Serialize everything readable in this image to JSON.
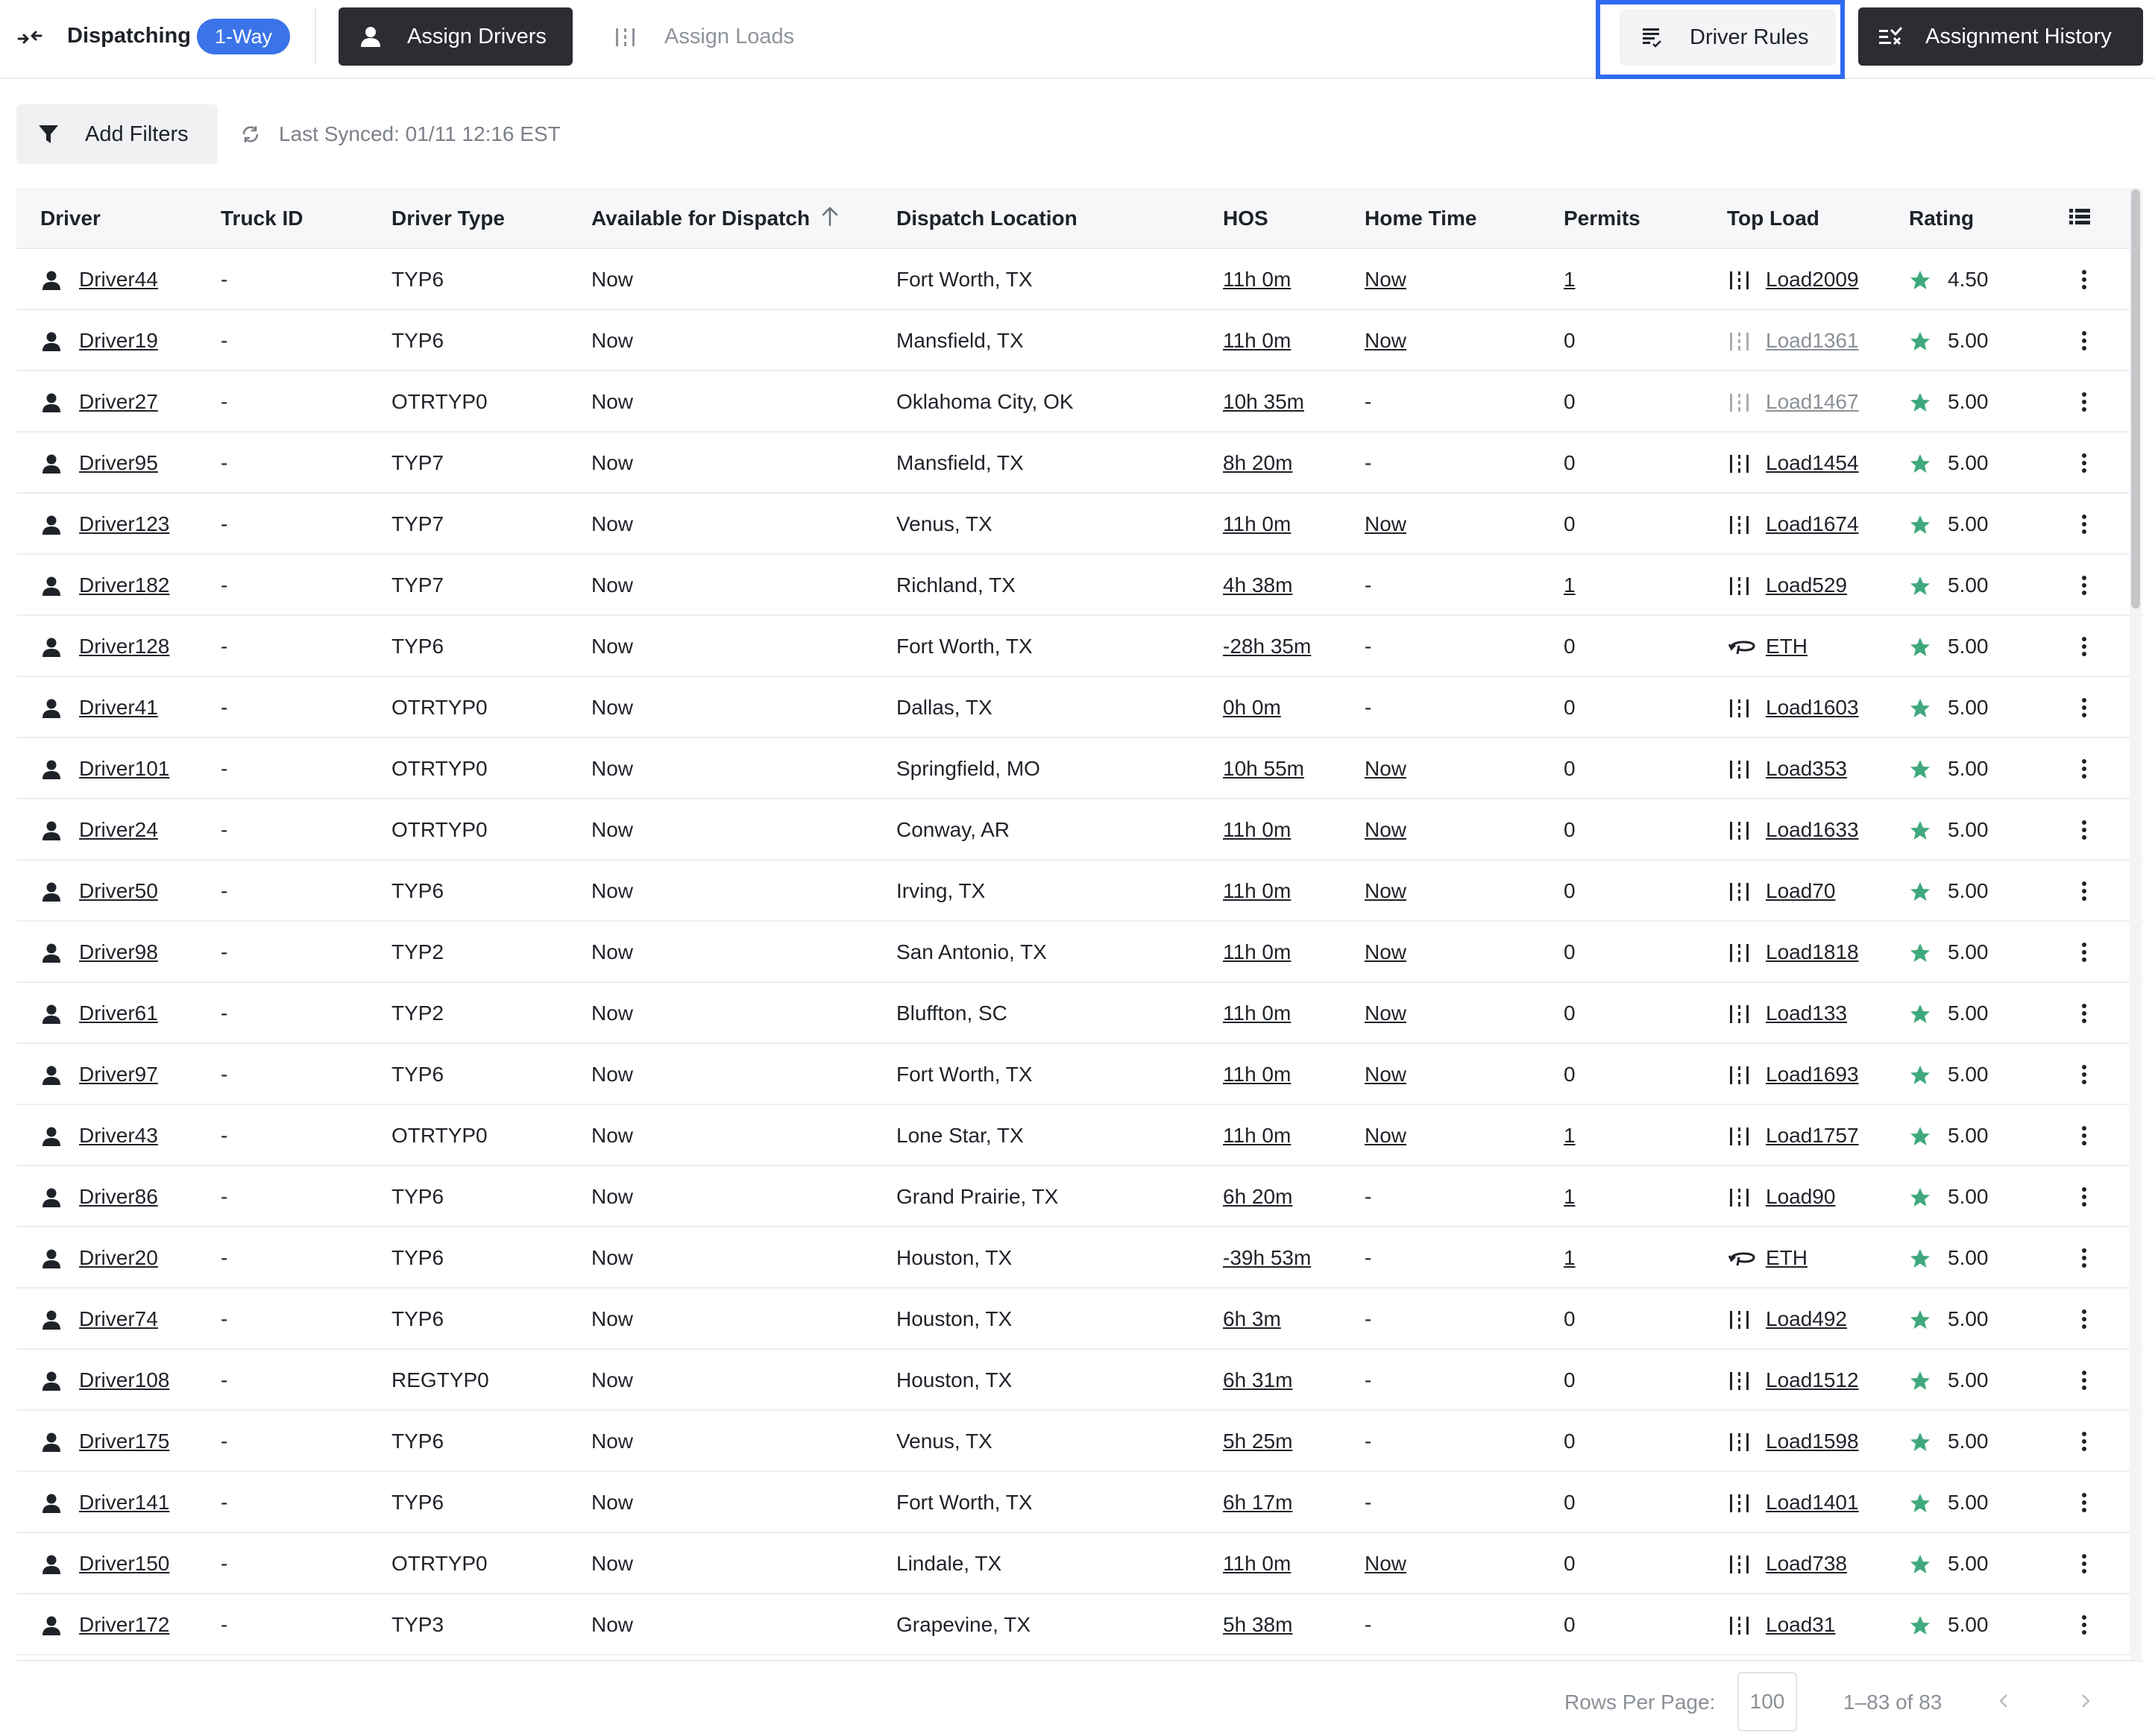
{
  "header": {
    "title": "Dispatching",
    "mode_badge": "1-Way",
    "tabs": [
      {
        "label": "Assign Drivers"
      },
      {
        "label": "Assign Loads"
      }
    ],
    "driver_rules_label": "Driver Rules",
    "assignment_history_label": "Assignment History"
  },
  "toolbar": {
    "add_filters_label": "Add Filters",
    "last_synced": "Last Synced: 01/11 12:16 EST"
  },
  "table": {
    "columns": [
      "Driver",
      "Truck ID",
      "Driver Type",
      "Available for Dispatch",
      "Dispatch Location",
      "HOS",
      "Home Time",
      "Permits",
      "Top Load",
      "Rating"
    ],
    "rows": [
      {
        "driver": "Driver44",
        "truck": "-",
        "type": "TYP6",
        "available": "Now",
        "location": "Fort Worth, TX",
        "hos": "11h 0m",
        "home": "Now",
        "permits": "1",
        "load": "Load2009",
        "load_kind": "load",
        "load_muted": false,
        "rating": "4.50"
      },
      {
        "driver": "Driver19",
        "truck": "-",
        "type": "TYP6",
        "available": "Now",
        "location": "Mansfield, TX",
        "hos": "11h 0m",
        "home": "Now",
        "permits": "0",
        "load": "Load1361",
        "load_kind": "load",
        "load_muted": true,
        "rating": "5.00"
      },
      {
        "driver": "Driver27",
        "truck": "-",
        "type": "OTRTYP0",
        "available": "Now",
        "location": "Oklahoma City, OK",
        "hos": "10h 35m",
        "home": "-",
        "permits": "0",
        "load": "Load1467",
        "load_kind": "load",
        "load_muted": true,
        "rating": "5.00"
      },
      {
        "driver": "Driver95",
        "truck": "-",
        "type": "TYP7",
        "available": "Now",
        "location": "Mansfield, TX",
        "hos": "8h 20m",
        "home": "-",
        "permits": "0",
        "load": "Load1454",
        "load_kind": "load",
        "load_muted": false,
        "rating": "5.00"
      },
      {
        "driver": "Driver123",
        "truck": "-",
        "type": "TYP7",
        "available": "Now",
        "location": "Venus, TX",
        "hos": "11h 0m",
        "home": "Now",
        "permits": "0",
        "load": "Load1674",
        "load_kind": "load",
        "load_muted": false,
        "rating": "5.00"
      },
      {
        "driver": "Driver182",
        "truck": "-",
        "type": "TYP7",
        "available": "Now",
        "location": "Richland, TX",
        "hos": "4h 38m",
        "home": "-",
        "permits": "1",
        "load": "Load529",
        "load_kind": "load",
        "load_muted": false,
        "rating": "5.00"
      },
      {
        "driver": "Driver128",
        "truck": "-",
        "type": "TYP6",
        "available": "Now",
        "location": "Fort Worth, TX",
        "hos": "-28h 35m",
        "home": "-",
        "permits": "0",
        "load": "ETH",
        "load_kind": "home",
        "load_muted": false,
        "rating": "5.00"
      },
      {
        "driver": "Driver41",
        "truck": "-",
        "type": "OTRTYP0",
        "available": "Now",
        "location": "Dallas, TX",
        "hos": "0h 0m",
        "home": "-",
        "permits": "0",
        "load": "Load1603",
        "load_kind": "load",
        "load_muted": false,
        "rating": "5.00"
      },
      {
        "driver": "Driver101",
        "truck": "-",
        "type": "OTRTYP0",
        "available": "Now",
        "location": "Springfield, MO",
        "hos": "10h 55m",
        "home": "Now",
        "permits": "0",
        "load": "Load353",
        "load_kind": "load",
        "load_muted": false,
        "rating": "5.00"
      },
      {
        "driver": "Driver24",
        "truck": "-",
        "type": "OTRTYP0",
        "available": "Now",
        "location": "Conway, AR",
        "hos": "11h 0m",
        "home": "Now",
        "permits": "0",
        "load": "Load1633",
        "load_kind": "load",
        "load_muted": false,
        "rating": "5.00"
      },
      {
        "driver": "Driver50",
        "truck": "-",
        "type": "TYP6",
        "available": "Now",
        "location": "Irving, TX",
        "hos": "11h 0m",
        "home": "Now",
        "permits": "0",
        "load": "Load70",
        "load_kind": "load",
        "load_muted": false,
        "rating": "5.00"
      },
      {
        "driver": "Driver98",
        "truck": "-",
        "type": "TYP2",
        "available": "Now",
        "location": "San Antonio, TX",
        "hos": "11h 0m",
        "home": "Now",
        "permits": "0",
        "load": "Load1818",
        "load_kind": "load",
        "load_muted": false,
        "rating": "5.00"
      },
      {
        "driver": "Driver61",
        "truck": "-",
        "type": "TYP2",
        "available": "Now",
        "location": "Bluffton, SC",
        "hos": "11h 0m",
        "home": "Now",
        "permits": "0",
        "load": "Load133",
        "load_kind": "load",
        "load_muted": false,
        "rating": "5.00"
      },
      {
        "driver": "Driver97",
        "truck": "-",
        "type": "TYP6",
        "available": "Now",
        "location": "Fort Worth, TX",
        "hos": "11h 0m",
        "home": "Now",
        "permits": "0",
        "load": "Load1693",
        "load_kind": "load",
        "load_muted": false,
        "rating": "5.00"
      },
      {
        "driver": "Driver43",
        "truck": "-",
        "type": "OTRTYP0",
        "available": "Now",
        "location": "Lone Star, TX",
        "hos": "11h 0m",
        "home": "Now",
        "permits": "1",
        "load": "Load1757",
        "load_kind": "load",
        "load_muted": false,
        "rating": "5.00"
      },
      {
        "driver": "Driver86",
        "truck": "-",
        "type": "TYP6",
        "available": "Now",
        "location": "Grand Prairie, TX",
        "hos": "6h 20m",
        "home": "-",
        "permits": "1",
        "load": "Load90",
        "load_kind": "load",
        "load_muted": false,
        "rating": "5.00"
      },
      {
        "driver": "Driver20",
        "truck": "-",
        "type": "TYP6",
        "available": "Now",
        "location": "Houston, TX",
        "hos": "-39h 53m",
        "home": "-",
        "permits": "1",
        "load": "ETH",
        "load_kind": "home",
        "load_muted": false,
        "rating": "5.00"
      },
      {
        "driver": "Driver74",
        "truck": "-",
        "type": "TYP6",
        "available": "Now",
        "location": "Houston, TX",
        "hos": "6h 3m",
        "home": "-",
        "permits": "0",
        "load": "Load492",
        "load_kind": "load",
        "load_muted": false,
        "rating": "5.00"
      },
      {
        "driver": "Driver108",
        "truck": "-",
        "type": "REGTYP0",
        "available": "Now",
        "location": "Houston, TX",
        "hos": "6h 31m",
        "home": "-",
        "permits": "0",
        "load": "Load1512",
        "load_kind": "load",
        "load_muted": false,
        "rating": "5.00"
      },
      {
        "driver": "Driver175",
        "truck": "-",
        "type": "TYP6",
        "available": "Now",
        "location": "Venus, TX",
        "hos": "5h 25m",
        "home": "-",
        "permits": "0",
        "load": "Load1598",
        "load_kind": "load",
        "load_muted": false,
        "rating": "5.00"
      },
      {
        "driver": "Driver141",
        "truck": "-",
        "type": "TYP6",
        "available": "Now",
        "location": "Fort Worth, TX",
        "hos": "6h 17m",
        "home": "-",
        "permits": "0",
        "load": "Load1401",
        "load_kind": "load",
        "load_muted": false,
        "rating": "5.00"
      },
      {
        "driver": "Driver150",
        "truck": "-",
        "type": "OTRTYP0",
        "available": "Now",
        "location": "Lindale, TX",
        "hos": "11h 0m",
        "home": "Now",
        "permits": "0",
        "load": "Load738",
        "load_kind": "load",
        "load_muted": false,
        "rating": "5.00"
      },
      {
        "driver": "Driver172",
        "truck": "-",
        "type": "TYP3",
        "available": "Now",
        "location": "Grapevine, TX",
        "hos": "5h 38m",
        "home": "-",
        "permits": "0",
        "load": "Load31",
        "load_kind": "load",
        "load_muted": false,
        "rating": "5.00"
      }
    ]
  },
  "pagination": {
    "rows_per_page_label": "Rows Per Page:",
    "rows_per_page": "100",
    "range": "1–83 of 83"
  },
  "icons": {
    "collapse": "collapse-arrows-icon",
    "person": "person-icon",
    "load": "load-bars-icon",
    "rules": "list-rules-icon",
    "history": "history-list-icon",
    "filter": "funnel-icon",
    "sync": "sync-icon",
    "sort": "sort-ascending-icon",
    "columns": "column-settings-icon",
    "home_route": "round-trip-icon",
    "star": "star-icon",
    "kebab": "kebab-menu-icon"
  },
  "colors": {
    "accent_blue": "#3b74e8",
    "focus_ring": "#2f6bf0",
    "dark_button": "#2b2d33",
    "star_green": "#3fa97c",
    "muted_text": "#8b9097"
  }
}
